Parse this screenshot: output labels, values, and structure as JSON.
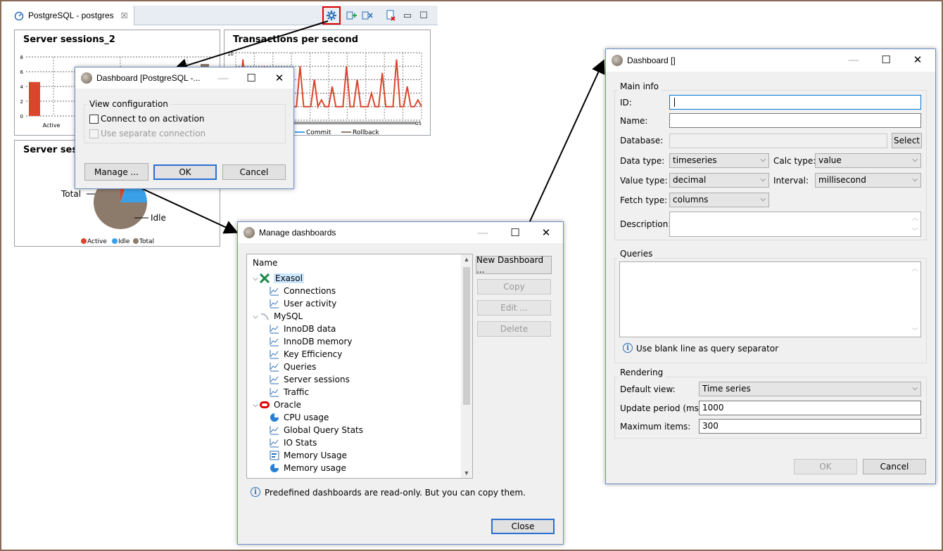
{
  "editor": {
    "tab_label": "PostgreSQL - postgres",
    "panels": {
      "sessions2": {
        "title": "Server sessions_2"
      },
      "tps": {
        "title": "Transactions per second"
      },
      "sessions_pie": {
        "title": "Server sessi"
      }
    }
  },
  "chart_data": [
    {
      "type": "bar",
      "title": "Server sessions_2",
      "categories": [
        "Active"
      ],
      "series": [
        {
          "name": "Active",
          "values": [
            4.6
          ]
        }
      ],
      "ylim": [
        0,
        8
      ],
      "yticks": [
        "8",
        "6",
        "4",
        "2",
        "0"
      ],
      "grid": true,
      "colors": [
        "#d9462b"
      ]
    },
    {
      "type": "line",
      "title": "Transactions per second",
      "yticks": [
        "10"
      ],
      "x_tick_partial": "05",
      "legend": [
        "tal",
        "Commit",
        "Rollback"
      ],
      "legend_colors": [
        "#d9462b",
        "#3aa0e8",
        "#8c7a6b"
      ],
      "series": [
        {
          "name": "tal",
          "values": [
            2,
            2,
            9,
            2,
            2,
            6,
            2,
            2,
            8,
            2,
            2,
            5,
            2,
            2,
            2,
            7,
            2,
            2,
            8,
            2,
            2,
            2,
            6,
            2,
            3,
            2,
            2,
            5,
            2,
            2,
            2,
            8,
            2,
            2,
            6,
            2,
            2,
            2,
            4,
            2,
            2,
            7,
            2,
            2,
            2,
            9,
            2,
            2,
            5,
            2,
            2,
            3,
            2
          ]
        }
      ],
      "grid": true
    },
    {
      "type": "pie",
      "title": "Server sessi",
      "categories": [
        "Active",
        "Idle",
        "Total"
      ],
      "values": [
        5,
        20,
        75
      ],
      "annotations": [
        "Total",
        "Idle"
      ],
      "legend": [
        "Active",
        "Idle",
        "Total"
      ],
      "colors": [
        "#d9462b",
        "#3aa0e8",
        "#8c7a6b"
      ]
    }
  ],
  "dash_small": {
    "title": "Dashboard [PostgreSQL -...",
    "group": "View configuration",
    "connect_label": "Connect to on activation",
    "separate_label": "Use separate connection",
    "manage": "Manage ...",
    "ok": "OK",
    "cancel": "Cancel"
  },
  "manage": {
    "title": "Manage dashboards",
    "column_header": "Name",
    "tree": [
      {
        "label": "Exasol",
        "level": 0,
        "icon": "exasol-icon",
        "selected": true
      },
      {
        "label": "Connections",
        "level": 1,
        "icon": "line-chart-icon"
      },
      {
        "label": "User activity",
        "level": 1,
        "icon": "line-chart-icon"
      },
      {
        "label": "MySQL",
        "level": 0,
        "icon": "mysql-icon"
      },
      {
        "label": "InnoDB data",
        "level": 1,
        "icon": "line-chart-icon"
      },
      {
        "label": "InnoDB memory",
        "level": 1,
        "icon": "line-chart-icon"
      },
      {
        "label": "Key Efficiency",
        "level": 1,
        "icon": "line-chart-icon"
      },
      {
        "label": "Queries",
        "level": 1,
        "icon": "line-chart-icon"
      },
      {
        "label": "Server sessions",
        "level": 1,
        "icon": "line-chart-icon"
      },
      {
        "label": "Traffic",
        "level": 1,
        "icon": "line-chart-icon"
      },
      {
        "label": "Oracle",
        "level": 0,
        "icon": "oracle-icon"
      },
      {
        "label": "CPU usage",
        "level": 1,
        "icon": "pie-chart-icon"
      },
      {
        "label": "Global Query Stats",
        "level": 1,
        "icon": "line-chart-icon"
      },
      {
        "label": "IO Stats",
        "level": 1,
        "icon": "line-chart-icon"
      },
      {
        "label": "Memory Usage",
        "level": 1,
        "icon": "bar-chart-icon"
      },
      {
        "label": "Memory usage",
        "level": 1,
        "icon": "pie-chart-icon"
      }
    ],
    "new_dashboard": "New Dashboard ...",
    "copy": "Copy",
    "edit": "Edit ...",
    "delete": "Delete",
    "info": "Predefined dashboards are read-only. But you can copy them.",
    "close": "Close"
  },
  "dash_big": {
    "title": "Dashboard []",
    "main_info": "Main info",
    "id_label": "ID:",
    "id_value": "",
    "name_label": "Name:",
    "name_value": "",
    "database_label": "Database:",
    "database_value": "",
    "select": "Select",
    "data_type_label": "Data type:",
    "data_type_value": "timeseries",
    "calc_type_label": "Calc type:",
    "calc_type_value": "value",
    "value_type_label": "Value type:",
    "value_type_value": "decimal",
    "interval_label": "Interval:",
    "interval_value": "millisecond",
    "fetch_type_label": "Fetch type:",
    "fetch_type_value": "columns",
    "description_label": "Description:",
    "queries": "Queries",
    "queries_info": "Use blank line as query separator",
    "rendering": "Rendering",
    "default_view_label": "Default view:",
    "default_view_value": "Time series",
    "update_period_label": "Update period (ms):",
    "update_period_value": "1000",
    "max_items_label": "Maximum items:",
    "max_items_value": "300",
    "ok": "OK",
    "cancel": "Cancel"
  }
}
